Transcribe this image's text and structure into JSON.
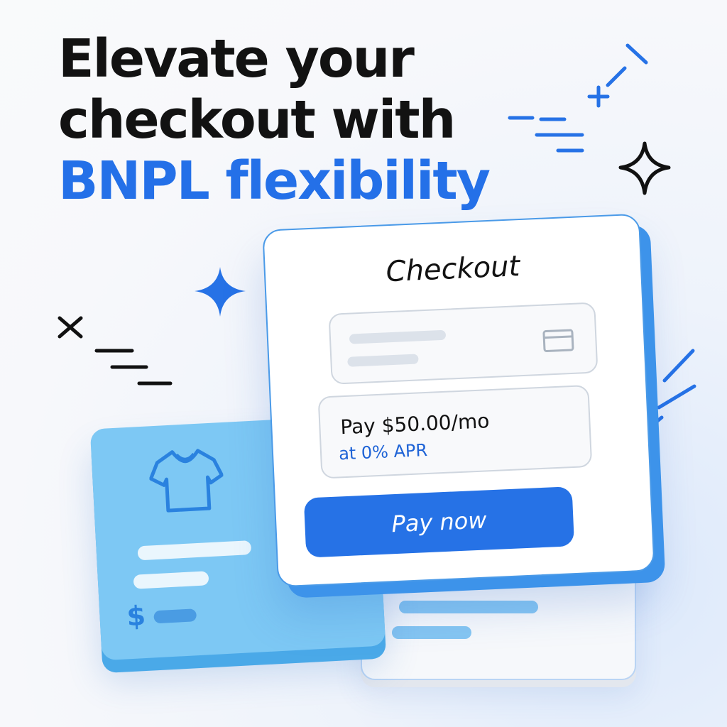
{
  "headline": {
    "line1": "Elevate your",
    "line2": "checkout with",
    "line3": "BNPL flexibility"
  },
  "checkout": {
    "title": "Checkout",
    "plan_amount": "Pay $50.00/mo",
    "plan_apr": "at 0% APR",
    "pay_button": "Pay now",
    "card_icon": "credit-card-icon"
  },
  "product": {
    "icon": "tshirt-icon",
    "currency_symbol": "$"
  },
  "decorations": {
    "icons": [
      "sparkle-icon",
      "blue-sparkle-icon",
      "close-x-icon",
      "plus-icon",
      "dot-icon"
    ]
  },
  "colors": {
    "accent": "#2470E8",
    "text": "#121212",
    "product_card": "#7DC8F4",
    "button": "#2672E6"
  }
}
